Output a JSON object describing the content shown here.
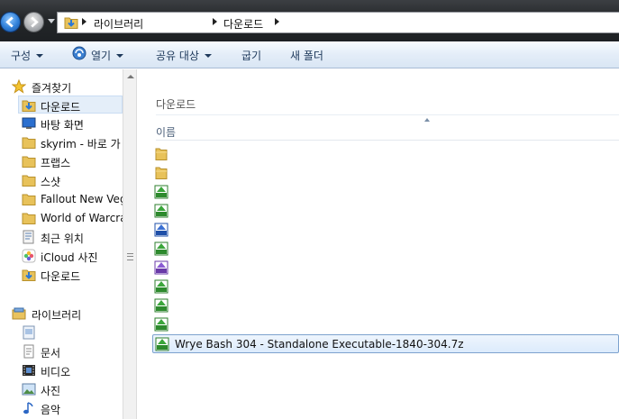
{
  "address_bar": {
    "crumbs": [
      "라이브러리",
      "다운로드"
    ]
  },
  "command_bar": {
    "organize": "구성",
    "open": "열기",
    "share": "공유 대상",
    "burn": "굽기",
    "new_folder": "새 폴더"
  },
  "nav_pane": {
    "favorites_header": "즐겨찾기",
    "favorites": [
      {
        "label": "다운로드",
        "icon": "download-folder-icon"
      },
      {
        "label": "바탕 화면",
        "icon": "desktop-icon"
      },
      {
        "label": "skyrim - 바로 가",
        "icon": "folder-icon"
      },
      {
        "label": "프랩스",
        "icon": "folder-icon"
      },
      {
        "label": "스샷",
        "icon": "folder-icon"
      },
      {
        "label": "Fallout New Veg",
        "icon": "folder-icon"
      },
      {
        "label": "World of Warcraf",
        "icon": "folder-icon"
      },
      {
        "label": "최근 위치",
        "icon": "recent-places-icon"
      },
      {
        "label": "iCloud 사진",
        "icon": "icloud-photos-icon"
      },
      {
        "label": "다운로드",
        "icon": "download-folder-icon"
      }
    ],
    "libraries_header": "라이브러리",
    "libraries": [
      {
        "label": "",
        "icon": "document-library-icon"
      },
      {
        "label": "문서",
        "icon": "documents-icon"
      },
      {
        "label": "비디오",
        "icon": "videos-icon"
      },
      {
        "label": "사진",
        "icon": "pictures-icon"
      },
      {
        "label": "음악",
        "icon": "music-icon"
      }
    ]
  },
  "content": {
    "library_title": "다운로드",
    "column_name": "이름",
    "files": [
      {
        "name": "",
        "icon": "folder-icon"
      },
      {
        "name": "",
        "icon": "folder-icon"
      },
      {
        "name": "",
        "icon": "7z-archive-icon"
      },
      {
        "name": "",
        "icon": "7z-archive-icon"
      },
      {
        "name": "",
        "icon": "zip-archive-icon"
      },
      {
        "name": "",
        "icon": "7z-archive-icon"
      },
      {
        "name": "",
        "icon": "rar-archive-icon"
      },
      {
        "name": "",
        "icon": "7z-archive-icon"
      },
      {
        "name": "",
        "icon": "7z-archive-icon"
      },
      {
        "name": "",
        "icon": "7z-archive-icon"
      },
      {
        "name": "Wrye Bash 304 - Standalone Executable-1840-304.7z",
        "icon": "7z-archive-icon",
        "selected": true
      }
    ]
  },
  "colors": {
    "selection_fill": "#dcebfc",
    "selection_border": "#7da2ce",
    "command_text": "#1e395b",
    "address_bar_bg": "#24272a"
  }
}
